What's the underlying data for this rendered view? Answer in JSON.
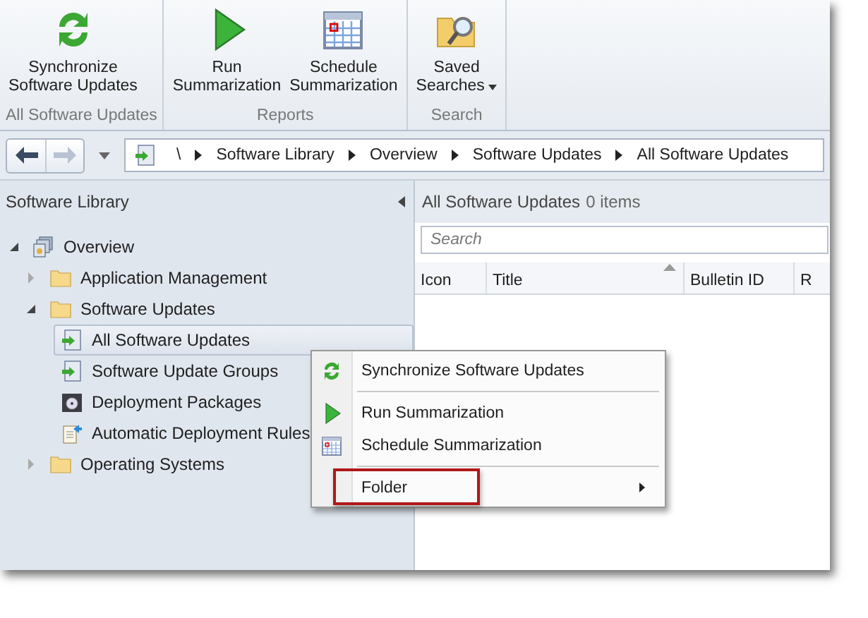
{
  "ribbon": {
    "groups": [
      {
        "label": "All Software Updates",
        "buttons": [
          {
            "lines": [
              "Synchronize",
              "Software Updates"
            ],
            "kind": "sync",
            "dropdown": false
          }
        ]
      },
      {
        "label": "Reports",
        "buttons": [
          {
            "lines": [
              "Run",
              "Summarization"
            ],
            "kind": "play",
            "dropdown": false
          },
          {
            "lines": [
              "Schedule",
              "Summarization"
            ],
            "kind": "calendar",
            "dropdown": false
          }
        ]
      },
      {
        "label": "Search",
        "buttons": [
          {
            "lines": [
              "Saved",
              "Searches"
            ],
            "kind": "folder-search",
            "dropdown": true
          }
        ]
      }
    ]
  },
  "nav": {
    "back_disabled": false,
    "forward_disabled": true,
    "breadcrumb": [
      "\\",
      "Software Library",
      "Overview",
      "Software Updates",
      "All Software Updates"
    ]
  },
  "sidebar": {
    "title": "Software Library",
    "tree": [
      {
        "label": "Overview",
        "kind": "overview",
        "expanded": true,
        "selected": false,
        "children": [
          {
            "label": "Application Management",
            "kind": "folder",
            "expanded": false,
            "selected": false
          },
          {
            "label": "Software Updates",
            "kind": "folder",
            "expanded": true,
            "selected": false,
            "children": [
              {
                "label": "All Software Updates",
                "kind": "updates",
                "selected": true
              },
              {
                "label": "Software Update Groups",
                "kind": "updates",
                "selected": false
              },
              {
                "label": "Deployment Packages",
                "kind": "package",
                "selected": false
              },
              {
                "label": "Automatic Deployment Rules",
                "kind": "rules",
                "selected": false
              }
            ]
          },
          {
            "label": "Operating Systems",
            "kind": "folder",
            "expanded": false,
            "selected": false
          }
        ]
      }
    ]
  },
  "content": {
    "title": "All Software Updates",
    "count": "0 items",
    "search": {
      "placeholder": "Search"
    },
    "columns": [
      {
        "label": "Icon",
        "sorted": false
      },
      {
        "label": "Title",
        "sorted": true
      },
      {
        "label": "Bulletin ID",
        "sorted": false
      },
      {
        "label": "R",
        "sorted": false
      }
    ]
  },
  "context_menu": {
    "items": [
      {
        "kind": "sync",
        "label": "Synchronize Software Updates",
        "submenu": false,
        "highlighted": false
      },
      {
        "kind": "separator"
      },
      {
        "kind": "play",
        "label": "Run Summarization",
        "submenu": false,
        "highlighted": false
      },
      {
        "kind": "calendar",
        "label": "Schedule Summarization",
        "submenu": false,
        "highlighted": false
      },
      {
        "kind": "separator"
      },
      {
        "kind": "plain",
        "label": "Folder",
        "submenu": true,
        "highlighted": true
      }
    ]
  }
}
